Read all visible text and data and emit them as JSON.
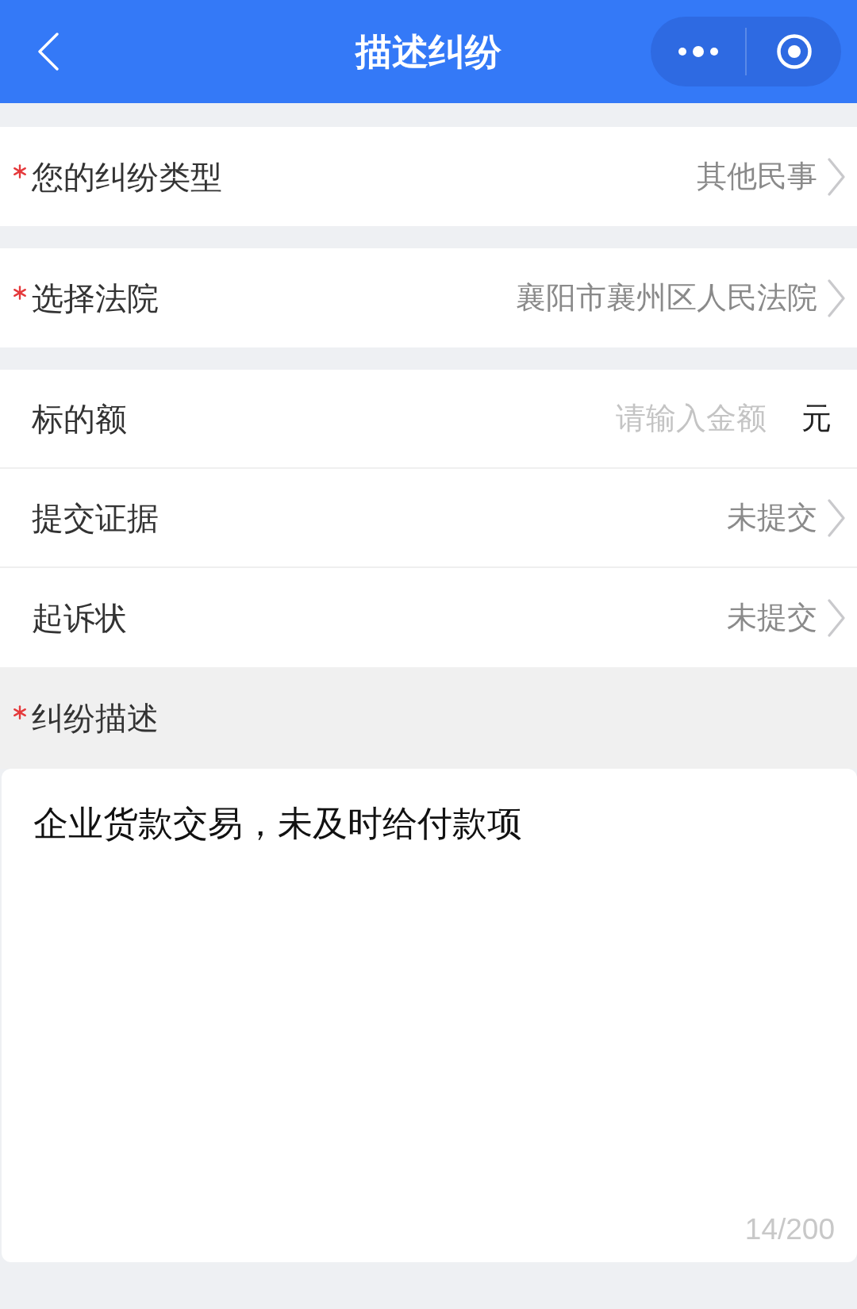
{
  "header": {
    "title": "描述纠纷"
  },
  "groups": [
    {
      "rows": [
        {
          "kind": "select",
          "label": "您的纠纷类型",
          "required": true,
          "value": "其他民事"
        }
      ]
    },
    {
      "rows": [
        {
          "kind": "select",
          "label": "选择法院",
          "required": true,
          "value": "襄阳市襄州区人民法院"
        }
      ]
    },
    {
      "rows": [
        {
          "kind": "input",
          "label": "标的额",
          "required": false,
          "placeholder": "请输入金额",
          "unit": "元"
        },
        {
          "kind": "select",
          "label": "提交证据",
          "required": false,
          "value": "未提交"
        },
        {
          "kind": "select",
          "label": "起诉状",
          "required": false,
          "value": "未提交"
        }
      ]
    }
  ],
  "description": {
    "label": "纠纷描述",
    "required": true,
    "value": "企业货款交易，未及时给付款项",
    "counter": "14/200"
  }
}
